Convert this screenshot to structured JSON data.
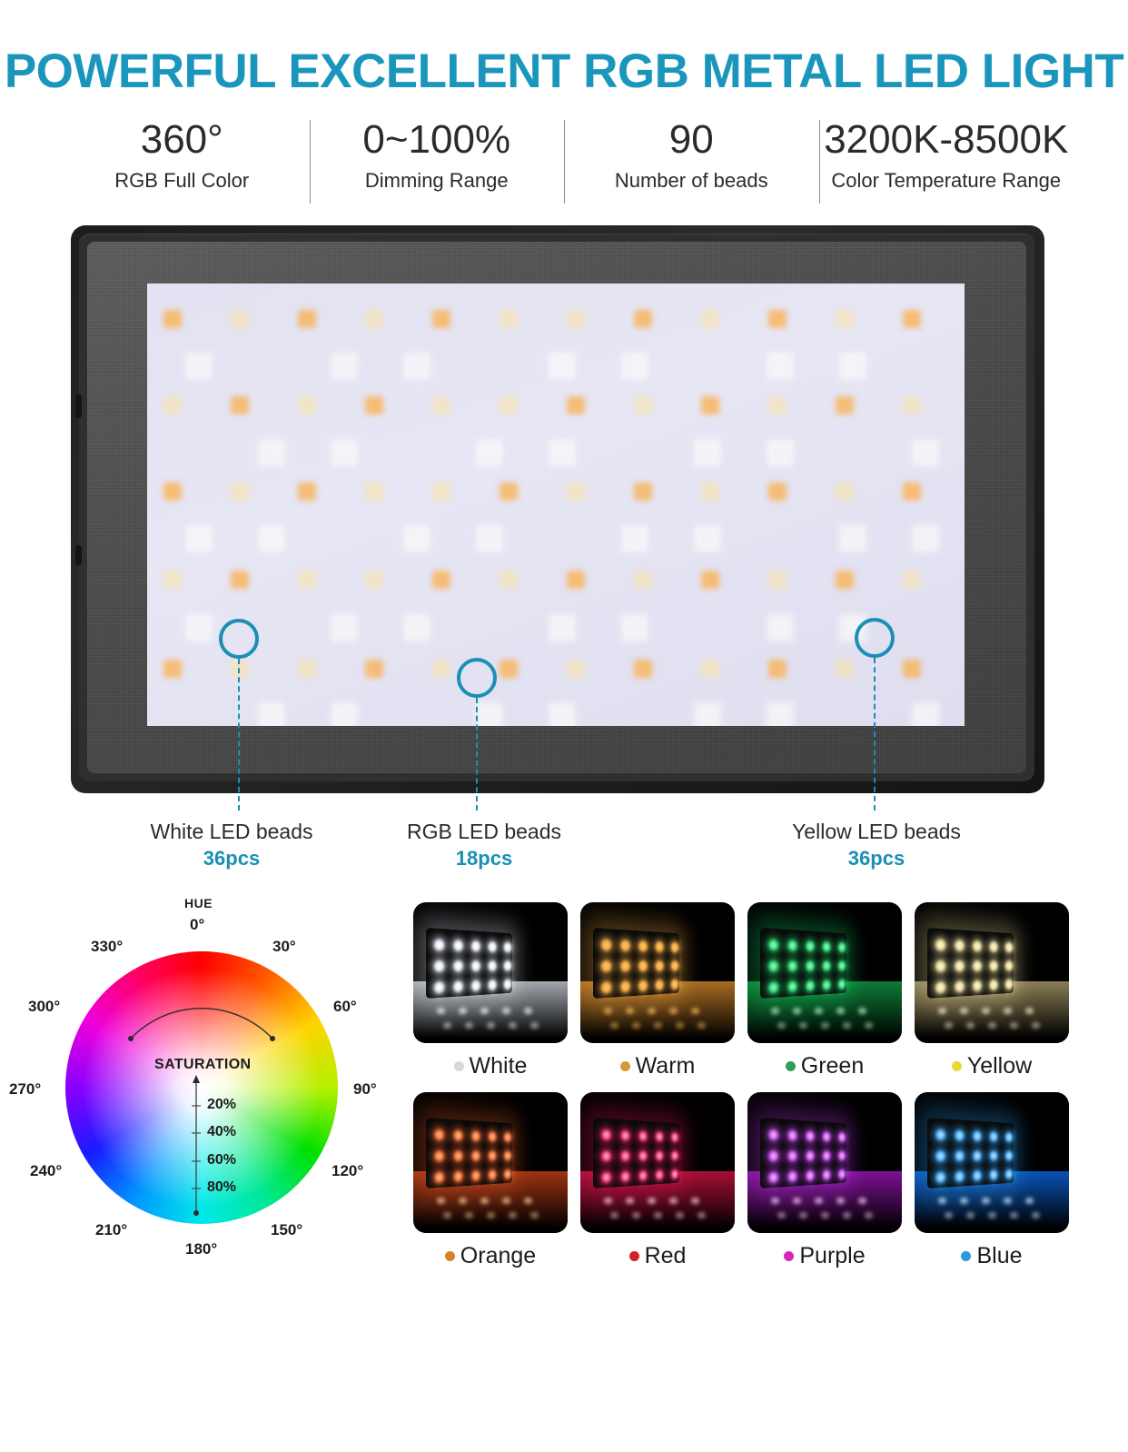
{
  "header": {
    "title": "POWERFUL EXCELLENT RGB METAL LED LIGHT",
    "title_color": "#1a96bd"
  },
  "stats": [
    {
      "value": "360°",
      "label": "RGB Full Color"
    },
    {
      "value": "0~100%",
      "label": "Dimming Range"
    },
    {
      "value": "90",
      "label": "Number of beads"
    },
    {
      "value": "3200K-8500K",
      "label": "Color Temperature Range"
    }
  ],
  "product": {
    "name": "rgb-metal-led-light-panel",
    "accent_color": "#1a8fb5",
    "bezel_color": "#2a2a2a",
    "frame_color": "#4a4a4a",
    "diffuser_color": "#e4e4f2",
    "bead_colors": {
      "white": "#fdfdfb",
      "orange": "#f9b55f",
      "yellow": "#fbe3a8"
    }
  },
  "callouts": [
    {
      "title": "White LED beads",
      "count": "36pcs"
    },
    {
      "title": "RGB LED beads",
      "count": "18pcs"
    },
    {
      "title": "Yellow LED beads",
      "count": "36pcs"
    }
  ],
  "color_wheel": {
    "hue_label": "HUE",
    "saturation_label": "SATURATION",
    "hue_ticks": [
      "0°",
      "30°",
      "60°",
      "90°",
      "120°",
      "150°",
      "180°",
      "210°",
      "240°",
      "270°",
      "300°",
      "330°"
    ],
    "saturation_ticks": [
      "20%",
      "40%",
      "60%",
      "80%"
    ]
  },
  "swatches": [
    {
      "label": "White",
      "dot": "#d9d9d9",
      "light": "#ffffff",
      "glow": "#eef3ff",
      "floor": "#b9bfc6"
    },
    {
      "label": "Warm",
      "dot": "#d79a3a",
      "light": "#ffc162",
      "glow": "#ffb347",
      "floor": "#c07a26"
    },
    {
      "label": "Green",
      "dot": "#2f9e56",
      "light": "#b5ffd2",
      "glow": "#19d96a",
      "floor": "#0f8c3e"
    },
    {
      "label": "Yellow",
      "dot": "#e8d832",
      "light": "#fff6cd",
      "glow": "#f2e3a0",
      "floor": "#9c8f62"
    },
    {
      "label": "Orange",
      "dot": "#d98324",
      "light": "#ffd39a",
      "glow": "#ef5f2a",
      "floor": "#b33a16"
    },
    {
      "label": "Red",
      "dot": "#d61f26",
      "light": "#ffd6ee",
      "glow": "#f11a5f",
      "floor": "#c0103c"
    },
    {
      "label": "Purple",
      "dot": "#d827b8",
      "light": "#ffd4f6",
      "glow": "#c23df0",
      "floor": "#8f12a8"
    },
    {
      "label": "Blue",
      "dot": "#2d9ad6",
      "light": "#dff0ff",
      "glow": "#31a7ff",
      "floor": "#0b5ed0"
    }
  ]
}
